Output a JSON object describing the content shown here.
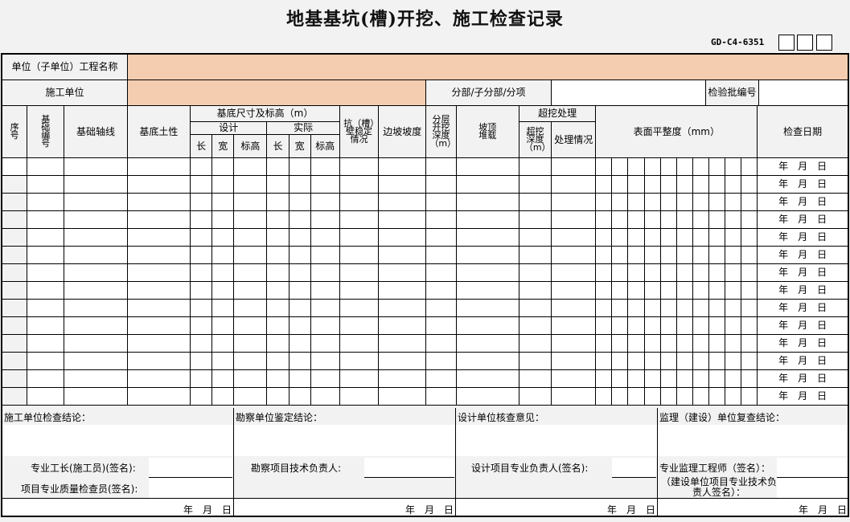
{
  "title": "地基基坑(槽)开挖、施工检查记录",
  "code": "GD-C4-6351",
  "row1": {
    "label": "单位（子单位）工程名称",
    "value": ""
  },
  "row2": {
    "label": "施工单位",
    "value": "",
    "sub_label": "分部/子分部/分项",
    "sub_value": "",
    "batch_label": "检验批编号",
    "batch_value": ""
  },
  "headers": {
    "seq": "序号",
    "base_no": "基础编号",
    "axis": "基础轴线",
    "soil": "基底土性",
    "size_group": "基底尺寸及标高（m）",
    "design": "设计",
    "actual": "实际",
    "len": "长",
    "wid": "宽",
    "elev": "标高",
    "wall": "抗（槽）壁稳定情况",
    "slope": "边坡坡度",
    "layer_depth": "分层开挖深度（m）",
    "top_load": "坡顶堆载",
    "over_group": "超挖处理",
    "over_depth": "超挖深度（m）",
    "handling": "处理情况",
    "flatness": "表面平整度（mm）",
    "date": "检查日期"
  },
  "date_text": "年　月　日",
  "row_count": 14,
  "sections": [
    {
      "conclusion": "施工单位检查结论：",
      "sign1": "专业工长(施工员)(签名):",
      "sign2": "项目专业质量检查员(签名):",
      "date": "年　月　日"
    },
    {
      "conclusion": "勘察单位鉴定结论：",
      "sign1": "勘察项目技术负责人:",
      "sign2": "",
      "date": "年　月　日"
    },
    {
      "conclusion": "设计单位核查意见：",
      "sign1": "设计项目专业负责人(签名):",
      "sign2": "",
      "date": "年　月　日"
    },
    {
      "conclusion": "监理（建设）单位复查结论：",
      "sign1": "专业监理工程师（签名）：",
      "sign2": "（建设单位项目专业技术负责人签名）：",
      "date": "年　月　日"
    }
  ]
}
